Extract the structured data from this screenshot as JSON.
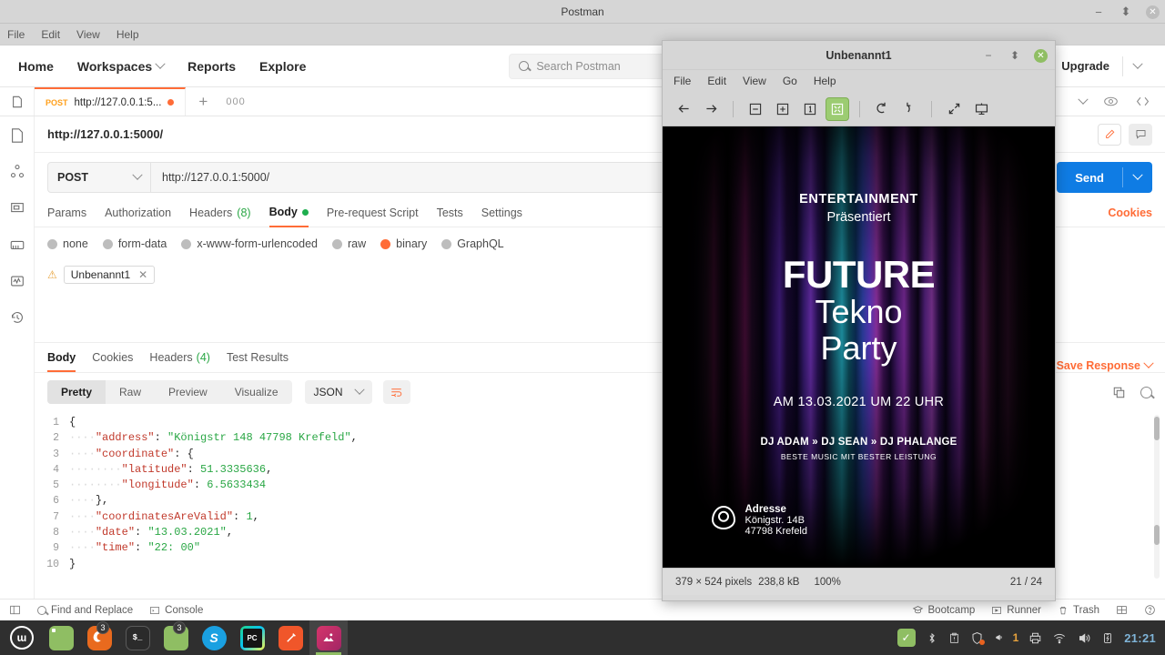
{
  "postman": {
    "window_title": "Postman",
    "menu": [
      "File",
      "Edit",
      "View",
      "Help"
    ],
    "nav": [
      "Home",
      "Workspaces",
      "Reports",
      "Explore"
    ],
    "search_placeholder": "Search Postman",
    "upgrade_label": "Upgrade",
    "tab": {
      "method": "POST",
      "label": "http://127.0.0.1:5...",
      "plus": "+",
      "dots": "000"
    },
    "request": {
      "title": "http://127.0.0.1:5000/",
      "method": "POST",
      "url": "http://127.0.0.1:5000/",
      "send_label": "Send",
      "tabs": [
        {
          "label": "Params"
        },
        {
          "label": "Authorization"
        },
        {
          "label": "Headers",
          "count": "(8)"
        },
        {
          "label": "Body",
          "active": true
        },
        {
          "label": "Pre-request Script"
        },
        {
          "label": "Tests"
        },
        {
          "label": "Settings"
        }
      ],
      "cookies_label": "Cookies",
      "body_types": [
        "none",
        "form-data",
        "x-www-form-urlencoded",
        "raw",
        "binary",
        "GraphQL"
      ],
      "body_type_selected": "binary",
      "file_chip": "Unbenannt1"
    },
    "response": {
      "tabs": [
        {
          "label": "Body",
          "active": true
        },
        {
          "label": "Cookies"
        },
        {
          "label": "Headers",
          "count": "(4)"
        },
        {
          "label": "Test Results"
        }
      ],
      "save_response_label": "Save Response",
      "format_segments": [
        "Pretty",
        "Raw",
        "Preview",
        "Visualize"
      ],
      "format_selected": "Pretty",
      "language": "JSON",
      "code_lines": [
        {
          "num": "1",
          "text": "{"
        },
        {
          "num": "2",
          "text": "    \"address\": \"Königstr 148 47798 Krefeld\","
        },
        {
          "num": "3",
          "text": "    \"coordinate\": {"
        },
        {
          "num": "4",
          "text": "        \"latitude\": 51.3335636,"
        },
        {
          "num": "5",
          "text": "        \"longitude\": 6.5633434"
        },
        {
          "num": "6",
          "text": "    },"
        },
        {
          "num": "7",
          "text": "    \"coordinatesAreValid\": 1,"
        },
        {
          "num": "8",
          "text": "    \"date\": \"13.03.2021\","
        },
        {
          "num": "9",
          "text": "    \"time\": \"22:00\""
        },
        {
          "num": "10",
          "text": "}"
        }
      ],
      "json_payload": {
        "address": "Königstr 148 47798 Krefeld",
        "coordinate": {
          "latitude": 51.3335636,
          "longitude": 6.5633434
        },
        "coordinatesAreValid": 1,
        "date": "13.03.2021",
        "time": "22:00"
      }
    },
    "status_bar": {
      "find_replace": "Find and Replace",
      "console": "Console",
      "bootcamp": "Bootcamp",
      "runner": "Runner",
      "trash": "Trash"
    }
  },
  "viewer": {
    "window_title": "Unbenannt1",
    "menu": [
      "File",
      "Edit",
      "View",
      "Go",
      "Help"
    ],
    "status": {
      "dimensions": "379 × 524 pixels",
      "filesize": "238,8 kB",
      "zoom": "100%",
      "page": "21 / 24"
    },
    "poster": {
      "entertainment": "ENTERTAINMENT",
      "praesentiert": "Präsentiert",
      "title_line1": "FUTURE",
      "title_line2": "Tekno",
      "title_line3": "Party",
      "date_line": "AM 13.03.2021 UM 22  UHR",
      "djs": "DJ ADAM » DJ SEAN » DJ PHALANGE",
      "tagline": "BESTE MUSIC MIT  BESTER  LEISTUNG",
      "address_label": "Adresse",
      "address_line1": "Königstr. 14B",
      "address_line2": "47798 Krefeld"
    }
  },
  "taskbar": {
    "clock": "21:21",
    "notification_count": "1",
    "apps": [
      {
        "name": "file-manager",
        "badge": ""
      },
      {
        "name": "firefox",
        "badge": "3"
      },
      {
        "name": "terminal",
        "badge": ""
      },
      {
        "name": "files",
        "badge": "3"
      },
      {
        "name": "skype",
        "badge": ""
      },
      {
        "name": "pycharm",
        "badge": ""
      },
      {
        "name": "postman",
        "badge": ""
      },
      {
        "name": "image-viewer",
        "badge": ""
      }
    ]
  },
  "colors": {
    "accent": "#ff6c37",
    "send_blue": "#0f7ce4",
    "green": "#2aa745",
    "mint_green": "#8fbe63"
  }
}
